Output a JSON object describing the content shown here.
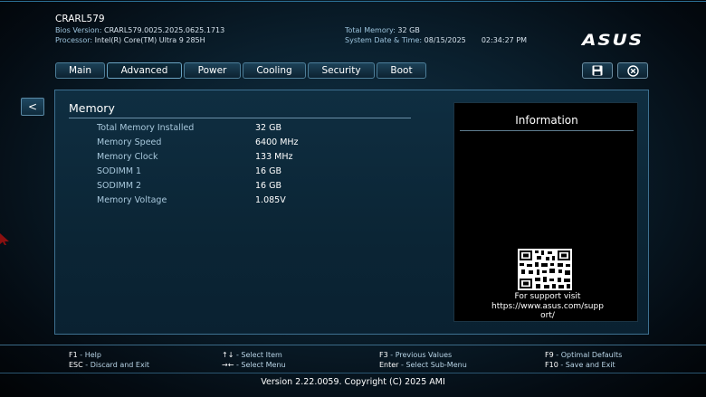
{
  "header": {
    "model": "CRARL579",
    "bios_label": "Bios Version:",
    "bios_value": "CRARL579.0025.2025.0625.1713",
    "processor_label": "Processor:",
    "processor_value": "Intel(R) Core(TM) Ultra 9 285H",
    "memory_label": "Total Memory:",
    "memory_value": "32 GB",
    "datetime_label": "System Date & Time:",
    "date_value": "08/15/2025",
    "time_value": "02:34:27 PM",
    "logo_text": "ASUS"
  },
  "tabs": [
    "Main",
    "Advanced",
    "Power",
    "Cooling",
    "Security",
    "Boot"
  ],
  "active_tab": "Advanced",
  "toolbar": {
    "save_icon": "save-icon",
    "exit_icon": "close-circle-icon"
  },
  "back_label": "<",
  "section": {
    "title": "Memory",
    "rows": [
      {
        "label": "Total Memory Installed",
        "value": "32 GB"
      },
      {
        "label": "Memory Speed",
        "value": "6400 MHz"
      },
      {
        "label": "Memory Clock",
        "value": "133 MHz"
      },
      {
        "label": "SODIMM 1",
        "value": "16 GB"
      },
      {
        "label": "SODIMM 2",
        "value": "16 GB"
      },
      {
        "label": "Memory Voltage",
        "value": "1.085V"
      }
    ]
  },
  "info": {
    "title": "Information",
    "support_line1": "For support visit",
    "support_line2": "https://www.asus.com/supp",
    "support_line3": "ort/"
  },
  "footer": {
    "items": [
      {
        "key": "F1",
        "desc": "Help"
      },
      {
        "key": "ESC",
        "desc": "Discard and Exit"
      },
      {
        "key": "↑↓",
        "desc": "Select Item"
      },
      {
        "key": "→←",
        "desc": "Select Menu"
      },
      {
        "key": "F3",
        "desc": "Previous Values"
      },
      {
        "key": "Enter",
        "desc": "Select Sub-Menu"
      },
      {
        "key": "F9",
        "desc": "Optimal Defaults"
      },
      {
        "key": "F10",
        "desc": "Save and Exit"
      }
    ],
    "separator": " - ",
    "version": "Version 2.22.0059. Copyright (C) 2025 AMI"
  },
  "colors": {
    "accent": "#3e7191",
    "label": "#a8c8dc",
    "background": "#0a1f2d"
  }
}
